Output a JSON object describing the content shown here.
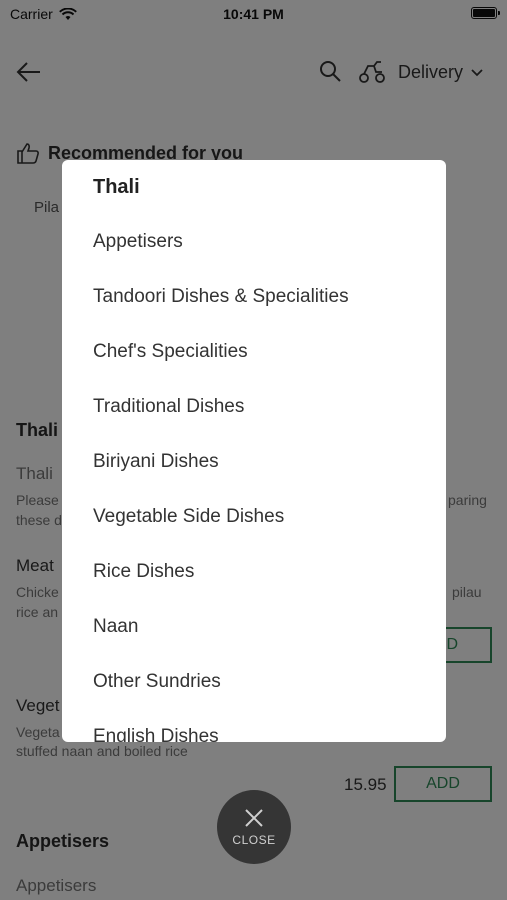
{
  "status": {
    "carrier": "Carrier",
    "time": "10:41 PM"
  },
  "topbar": {
    "delivery_label": "Delivery"
  },
  "background": {
    "recommended": "Recommended for you",
    "rec_item": "Pila",
    "thali_section": "Thali",
    "thali_subtitle": "Thali",
    "thali_desc_left": "Please",
    "thali_desc_right": "paring",
    "thali_desc_line2": "these d",
    "meat_title": "Meat",
    "meat_desc_left": "Chicke",
    "meat_desc_right": "pilau",
    "meat_desc_line2": "rice an",
    "add_partial": "D",
    "veg_title": "Veget",
    "veg_desc_line1": "Vegeta",
    "veg_desc_line2": "stuffed naan and boiled rice",
    "veg_price": "15.95",
    "add_label": "ADD",
    "appetisers_section": "Appetisers",
    "appetisers_subtitle": "Appetisers"
  },
  "modal": {
    "title": "Thali",
    "items": [
      "Appetisers",
      "Tandoori Dishes & Specialities",
      "Chef's Specialities",
      "Traditional Dishes",
      "Biriyani Dishes",
      "Vegetable Side Dishes",
      "Rice Dishes",
      "Naan",
      "Other Sundries",
      "English Dishes"
    ]
  },
  "close_button": {
    "label": "CLOSE"
  },
  "colors": {
    "accent": "#2e8b57",
    "overlay": "#000000"
  }
}
